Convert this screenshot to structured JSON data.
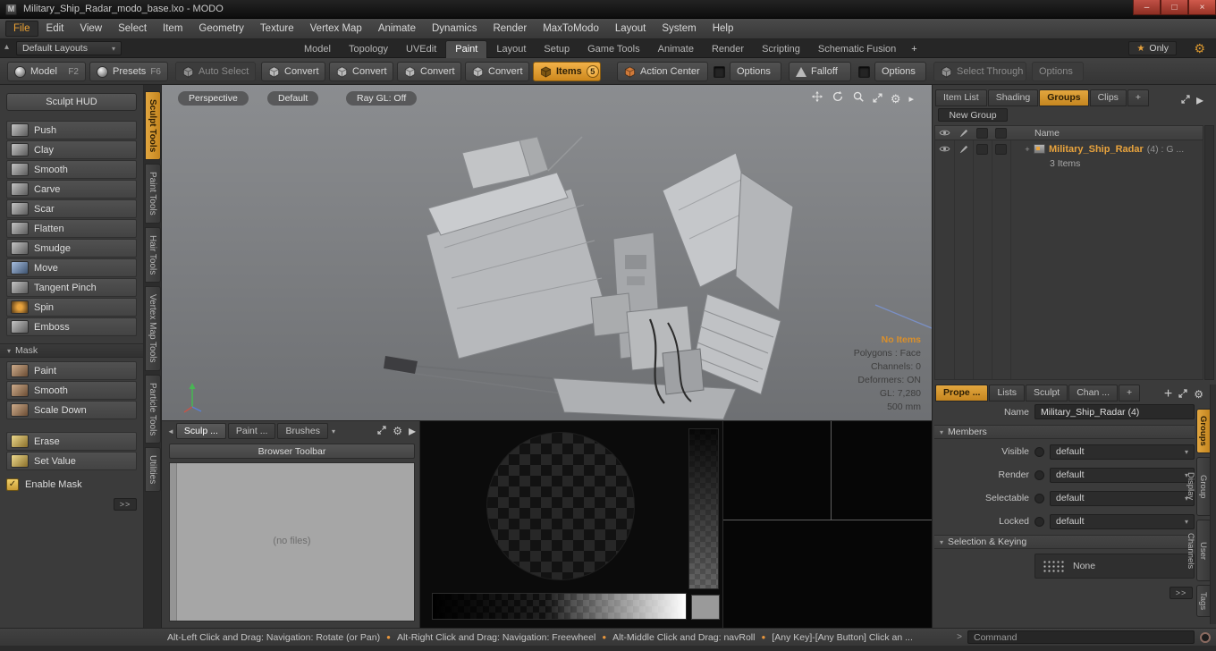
{
  "colors": {
    "accent_orange": "#e8a33d",
    "tab_orange": "#d6952f",
    "close_red": "#b0352c"
  },
  "window": {
    "title": "Military_Ship_Radar_modo_base.lxo - MODO",
    "controls": {
      "minimize": "–",
      "maximize": "□",
      "close": "×"
    }
  },
  "menubar": {
    "items": [
      "File",
      "Edit",
      "View",
      "Select",
      "Item",
      "Geometry",
      "Texture",
      "Vertex Map",
      "Animate",
      "Dynamics",
      "Render",
      "MaxToModo",
      "Layout",
      "System",
      "Help"
    ],
    "active": "File"
  },
  "layout_bar": {
    "preset_dropdown": "Default Layouts",
    "tabs": [
      "Model",
      "Topology",
      "UVEdit",
      "Paint",
      "Layout",
      "Setup",
      "Game Tools",
      "Animate",
      "Render",
      "Scripting",
      "Schematic Fusion",
      "+"
    ],
    "active_tab": "Paint",
    "star": "★",
    "only_label": "Only"
  },
  "toolbar": {
    "model_label": "Model",
    "model_key": "F2",
    "presets_label": "Presets",
    "presets_key": "F6",
    "auto_select_label": "Auto Select",
    "convert_label": "Convert",
    "items_label": "Items",
    "items_badge": "5",
    "action_center_label": "Action Center",
    "options_label": "Options",
    "falloff_label": "Falloff",
    "select_through_label": "Select Through"
  },
  "left_sidebar": {
    "header": "Sculpt HUD",
    "tools": [
      {
        "label": "Push",
        "icon": "gray"
      },
      {
        "label": "Clay",
        "icon": "gray"
      },
      {
        "label": "Smooth",
        "icon": "gray"
      },
      {
        "label": "Carve",
        "icon": "gray"
      },
      {
        "label": "Scar",
        "icon": "gray"
      },
      {
        "label": "Flatten",
        "icon": "gray"
      },
      {
        "label": "Smudge",
        "icon": "gray"
      },
      {
        "label": "Move",
        "icon": "blue"
      },
      {
        "label": "Tangent Pinch",
        "icon": "gray"
      },
      {
        "label": "Spin",
        "icon": "orange"
      },
      {
        "label": "Emboss",
        "icon": "gray"
      }
    ],
    "mask_header": "Mask",
    "mask_tools": [
      {
        "label": "Paint",
        "icon": "brown"
      },
      {
        "label": "Smooth",
        "icon": "brown"
      },
      {
        "label": "Scale Down",
        "icon": "brown"
      }
    ],
    "value_tools": [
      {
        "label": "Erase",
        "icon": "yellow"
      },
      {
        "label": "Set Value",
        "icon": "yellow"
      }
    ],
    "enable_mask_label": "Enable Mask",
    "expand_label": ">>"
  },
  "tool_tabs": {
    "items": [
      "Sculpt Tools",
      "Paint Tools",
      "Hair Tools",
      "Vertex Map Tools",
      "Particle Tools",
      "Utilities"
    ],
    "active": "Sculpt Tools"
  },
  "viewport": {
    "camera_button": "Perspective",
    "shading_button": "Default",
    "raygl_button": "Ray GL: Off",
    "status": {
      "selection": "No Items",
      "polygons": "Polygons : Face",
      "channels": "Channels: 0",
      "deformers": "Deformers: ON",
      "gl": "GL: 7,280",
      "scale": "500 mm"
    }
  },
  "right_panel": {
    "tabs": [
      "Item List",
      "Shading",
      "Groups",
      "Clips",
      "+"
    ],
    "active_tab": "Groups",
    "new_group_button": "New Group",
    "name_header": "Name",
    "item": {
      "name": "Military_Ship_Radar",
      "suffix": "(4) : G ...",
      "count": "3 Items"
    }
  },
  "properties_panel": {
    "tabs": [
      "Prope ...",
      "Lists",
      "Sculpt",
      "Chan ...",
      "+"
    ],
    "active_tab": "Prope ...",
    "name_label": "Name",
    "name_value": "Military_Ship_Radar (4)",
    "members": {
      "header": "Members",
      "rows": [
        {
          "label": "Visible",
          "value": "default"
        },
        {
          "label": "Render",
          "value": "default"
        },
        {
          "label": "Selectable",
          "value": "default"
        },
        {
          "label": "Locked",
          "value": "default"
        }
      ]
    },
    "selection_keying": {
      "header": "Selection & Keying",
      "value": "None"
    },
    "expand_label": ">>"
  },
  "right_edge_tabs": {
    "items": [
      "Groups",
      "Group Display",
      "User Channels",
      "Tags"
    ],
    "active": "Groups"
  },
  "browser_panel": {
    "tabs": [
      "Sculp ...",
      "Paint ...",
      "Brushes"
    ],
    "active_tab": "Sculp ...",
    "toolbar_button": "Browser Toolbar",
    "empty_text": "(no files)"
  },
  "status_bar": {
    "segments": [
      "Alt-Left Click and Drag: Navigation: Rotate (or Pan)",
      "Alt-Right Click and Drag: Navigation: Freewheel",
      "Alt-Middle Click and Drag: navRoll",
      "[Any Key]-[Any Button] Click an ..."
    ],
    "separator": "●",
    "command_prompt": ">",
    "command_value": "Command"
  }
}
